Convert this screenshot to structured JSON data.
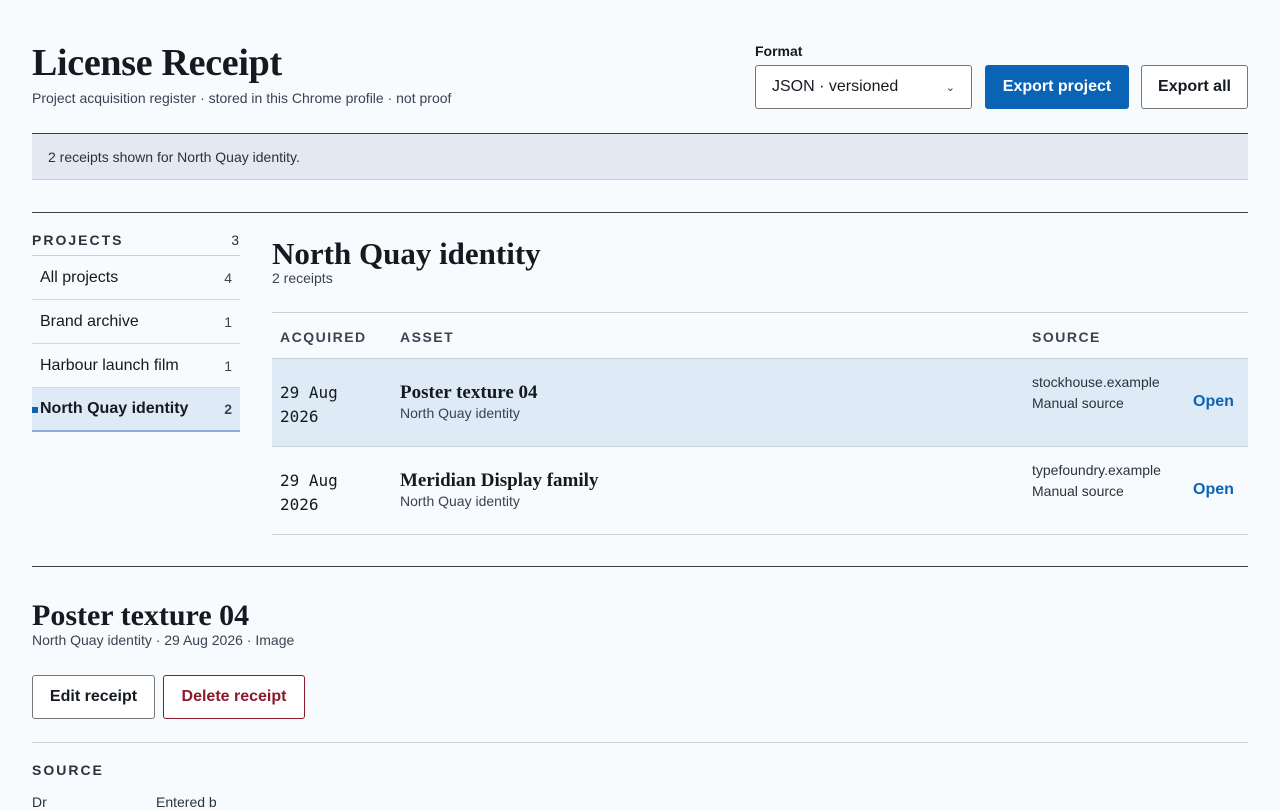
{
  "header": {
    "title": "License Receipt",
    "subtitle": "Project acquisition register · stored in this Chrome profile · not proof",
    "format_label": "Format",
    "format_value": "JSON · versioned",
    "export_project_label": "Export project",
    "export_all_label": "Export all"
  },
  "status": {
    "message": "2 receipts shown for North Quay identity."
  },
  "sidebar": {
    "heading": "PROJECTS",
    "count": "3",
    "items": [
      {
        "label": "All projects",
        "count": "4"
      },
      {
        "label": "Brand archive",
        "count": "1"
      },
      {
        "label": "Harbour launch film",
        "count": "1"
      },
      {
        "label": "North Quay identity",
        "count": "2"
      }
    ]
  },
  "project": {
    "title": "North Quay identity",
    "count": "2 receipts",
    "columns": {
      "acquired": "ACQUIRED",
      "asset": "ASSET",
      "source": "SOURCE"
    },
    "rows": [
      {
        "date_line1": "29 Aug",
        "date_line2": "2026",
        "asset": "Poster texture 04",
        "project": "North Quay identity",
        "source": "stockhouse.example",
        "source_type": "Manual source",
        "action": "Open"
      },
      {
        "date_line1": "29 Aug",
        "date_line2": "2026",
        "asset": "Meridian Display family",
        "project": "North Quay identity",
        "source": "typefoundry.example",
        "source_type": "Manual source",
        "action": "Open"
      }
    ]
  },
  "detail": {
    "title": "Poster texture 04",
    "meta": "North Quay identity · 29 Aug 2026 · Image",
    "edit_label": "Edit receipt",
    "delete_label": "Delete receipt",
    "section_label": "SOURCE",
    "partial_label": "Dr",
    "partial_value": "Entered b"
  },
  "colors": {
    "accent": "#0b63b6",
    "danger": "#8a1a2c",
    "selected_row": "#dfeaf7",
    "status_bg": "#e3e9f1"
  }
}
